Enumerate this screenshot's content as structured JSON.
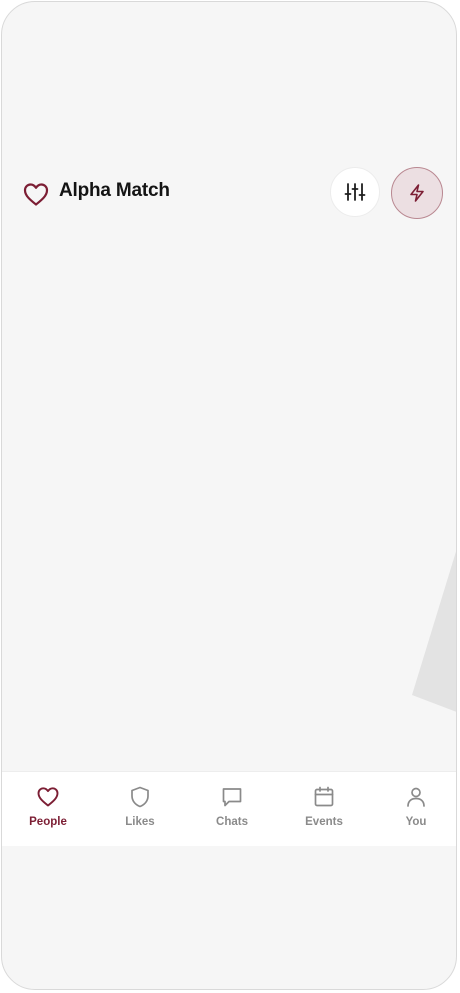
{
  "app": {
    "title": "Alpha Match"
  },
  "header": {
    "logo_icon": "heart-icon",
    "filter_icon": "sliders-icon",
    "boost_icon": "bolt-icon"
  },
  "colors": {
    "brand": "#7c1e34",
    "inactive": "#8a8a8a",
    "boost_bg": "#ecdfe2",
    "background": "#f6f6f6"
  },
  "tabs": [
    {
      "label": "People",
      "icon": "heart-icon",
      "active": true
    },
    {
      "label": "Likes",
      "icon": "shield-icon",
      "active": false
    },
    {
      "label": "Chats",
      "icon": "chat-bubble-icon",
      "active": false
    },
    {
      "label": "Events",
      "icon": "calendar-icon",
      "active": false
    },
    {
      "label": "You",
      "icon": "person-icon",
      "active": false
    }
  ]
}
